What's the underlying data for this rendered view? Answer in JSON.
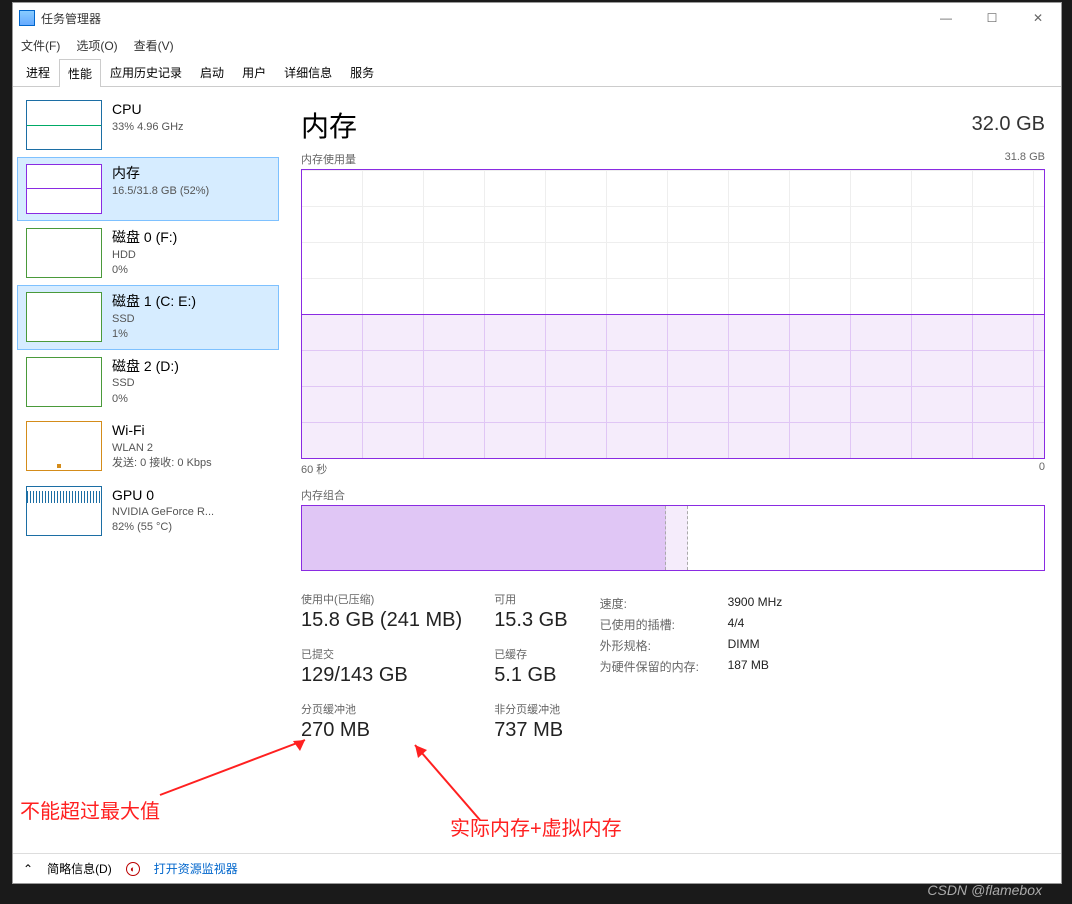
{
  "window": {
    "title": "任务管理器"
  },
  "menu": {
    "file": "文件(F)",
    "options": "选项(O)",
    "view": "查看(V)"
  },
  "tabs": {
    "processes": "进程",
    "performance": "性能",
    "app_history": "应用历史记录",
    "startup": "启动",
    "users": "用户",
    "details": "详细信息",
    "services": "服务"
  },
  "sidebar": [
    {
      "title": "CPU",
      "sub": "33% 4.96 GHz",
      "kind": "cpu"
    },
    {
      "title": "内存",
      "sub": "16.5/31.8 GB (52%)",
      "kind": "mem"
    },
    {
      "title": "磁盘 0 (F:)",
      "sub": "HDD",
      "sub2": "0%",
      "kind": "disk"
    },
    {
      "title": "磁盘 1 (C: E:)",
      "sub": "SSD",
      "sub2": "1%",
      "kind": "disk"
    },
    {
      "title": "磁盘 2 (D:)",
      "sub": "SSD",
      "sub2": "0%",
      "kind": "disk"
    },
    {
      "title": "Wi-Fi",
      "sub": "WLAN 2",
      "sub2": "发送: 0 接收: 0 Kbps",
      "kind": "wifi"
    },
    {
      "title": "GPU 0",
      "sub": "NVIDIA GeForce R...",
      "sub2": "82% (55 °C)",
      "kind": "gpu"
    }
  ],
  "main": {
    "title": "内存",
    "total": "32.0 GB",
    "usage_label": "内存使用量",
    "usage_max": "31.8 GB",
    "axis_left": "60 秒",
    "axis_right": "0",
    "composition_label": "内存组合"
  },
  "stats": {
    "inuse_label": "使用中(已压缩)",
    "inuse_value": "15.8 GB (241 MB)",
    "committed_label": "已提交",
    "committed_value": "129/143 GB",
    "paged_label": "分页缓冲池",
    "paged_value": "270 MB",
    "avail_label": "可用",
    "avail_value": "15.3 GB",
    "cached_label": "已缓存",
    "cached_value": "5.1 GB",
    "nonpaged_label": "非分页缓冲池",
    "nonpaged_value": "737 MB"
  },
  "info": {
    "speed_k": "速度:",
    "speed_v": "3900 MHz",
    "slots_k": "已使用的插槽:",
    "slots_v": "4/4",
    "form_k": "外形规格:",
    "form_v": "DIMM",
    "reserved_k": "为硬件保留的内存:",
    "reserved_v": "187 MB"
  },
  "bottom": {
    "fewer": "简略信息(D)",
    "resmon": "打开资源监视器"
  },
  "annotations": {
    "a1": "不能超过最大值",
    "a2": "实际内存+虚拟内存"
  },
  "watermark": "CSDN @flamebox",
  "chart_data": {
    "type": "area",
    "title": "内存使用量",
    "ylabel": "GB",
    "ylim": [
      0,
      31.8
    ],
    "xlim_seconds": [
      60,
      0
    ],
    "series": [
      {
        "name": "内存",
        "approx_constant_value": 16.0
      }
    ]
  }
}
